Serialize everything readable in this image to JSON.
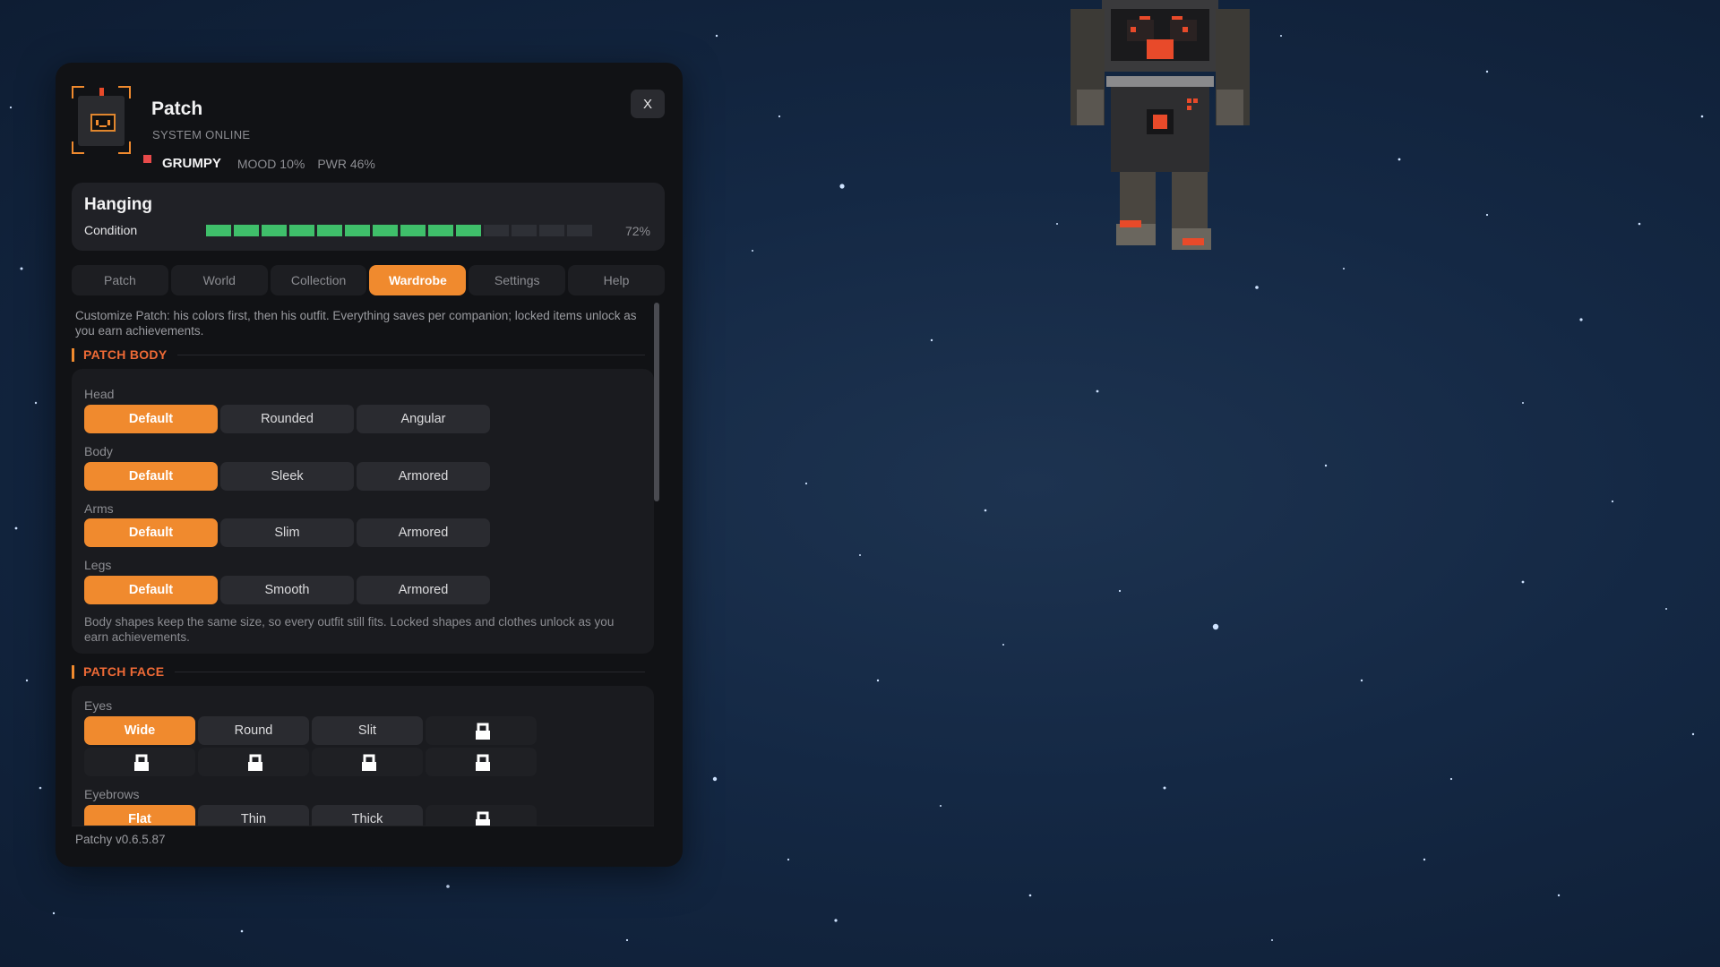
{
  "companion": {
    "name": "Patch",
    "system_status": "SYSTEM ONLINE",
    "mood_name": "GRUMPY",
    "mood_stat": "MOOD 10%",
    "power_stat": "PWR 46%",
    "close_label": "X"
  },
  "state": {
    "title": "Hanging",
    "condition_label": "Condition",
    "condition_percent": "72%",
    "condition_value": 72,
    "segments_total": 14,
    "segments_filled": 10
  },
  "tabs": [
    {
      "label": "Patch"
    },
    {
      "label": "World"
    },
    {
      "label": "Collection"
    },
    {
      "label": "Wardrobe",
      "active": true
    },
    {
      "label": "Settings"
    },
    {
      "label": "Help"
    }
  ],
  "wardrobe": {
    "intro": "Customize Patch: his colors first, then his outfit. Everything saves per companion; locked items unlock as you earn achievements.",
    "body_section": {
      "title": "PATCH BODY",
      "groups": [
        {
          "label": "Head",
          "options": [
            "Default",
            "Rounded",
            "Angular"
          ],
          "selected": "Default"
        },
        {
          "label": "Body",
          "options": [
            "Default",
            "Sleek",
            "Armored"
          ],
          "selected": "Default"
        },
        {
          "label": "Arms",
          "options": [
            "Default",
            "Slim",
            "Armored"
          ],
          "selected": "Default"
        },
        {
          "label": "Legs",
          "options": [
            "Default",
            "Smooth",
            "Armored"
          ],
          "selected": "Default"
        }
      ],
      "note": "Body shapes keep the same size, so every outfit still fits. Locked shapes and clothes unlock as you earn achievements."
    },
    "face_section": {
      "title": "PATCH FACE",
      "eyes_label": "Eyes",
      "eyes_options": [
        "Wide",
        "Round",
        "Slit"
      ],
      "eyes_selected": "Wide",
      "eyebrows_label": "Eyebrows",
      "eyebrows_options": [
        "Flat",
        "Thin",
        "Thick"
      ],
      "eyebrows_selected": "Flat"
    }
  },
  "footer": {
    "version": "Patchy v0.6.5.87"
  },
  "colors": {
    "accent": "#f08a2e",
    "section_title": "#ee6a36",
    "condition_fill": "#3fbf6a",
    "panel_bg": "#111215",
    "mood_indicator": "#e84a4a"
  },
  "icons": {
    "close": "close-icon",
    "locked_item": "lock-icon"
  }
}
